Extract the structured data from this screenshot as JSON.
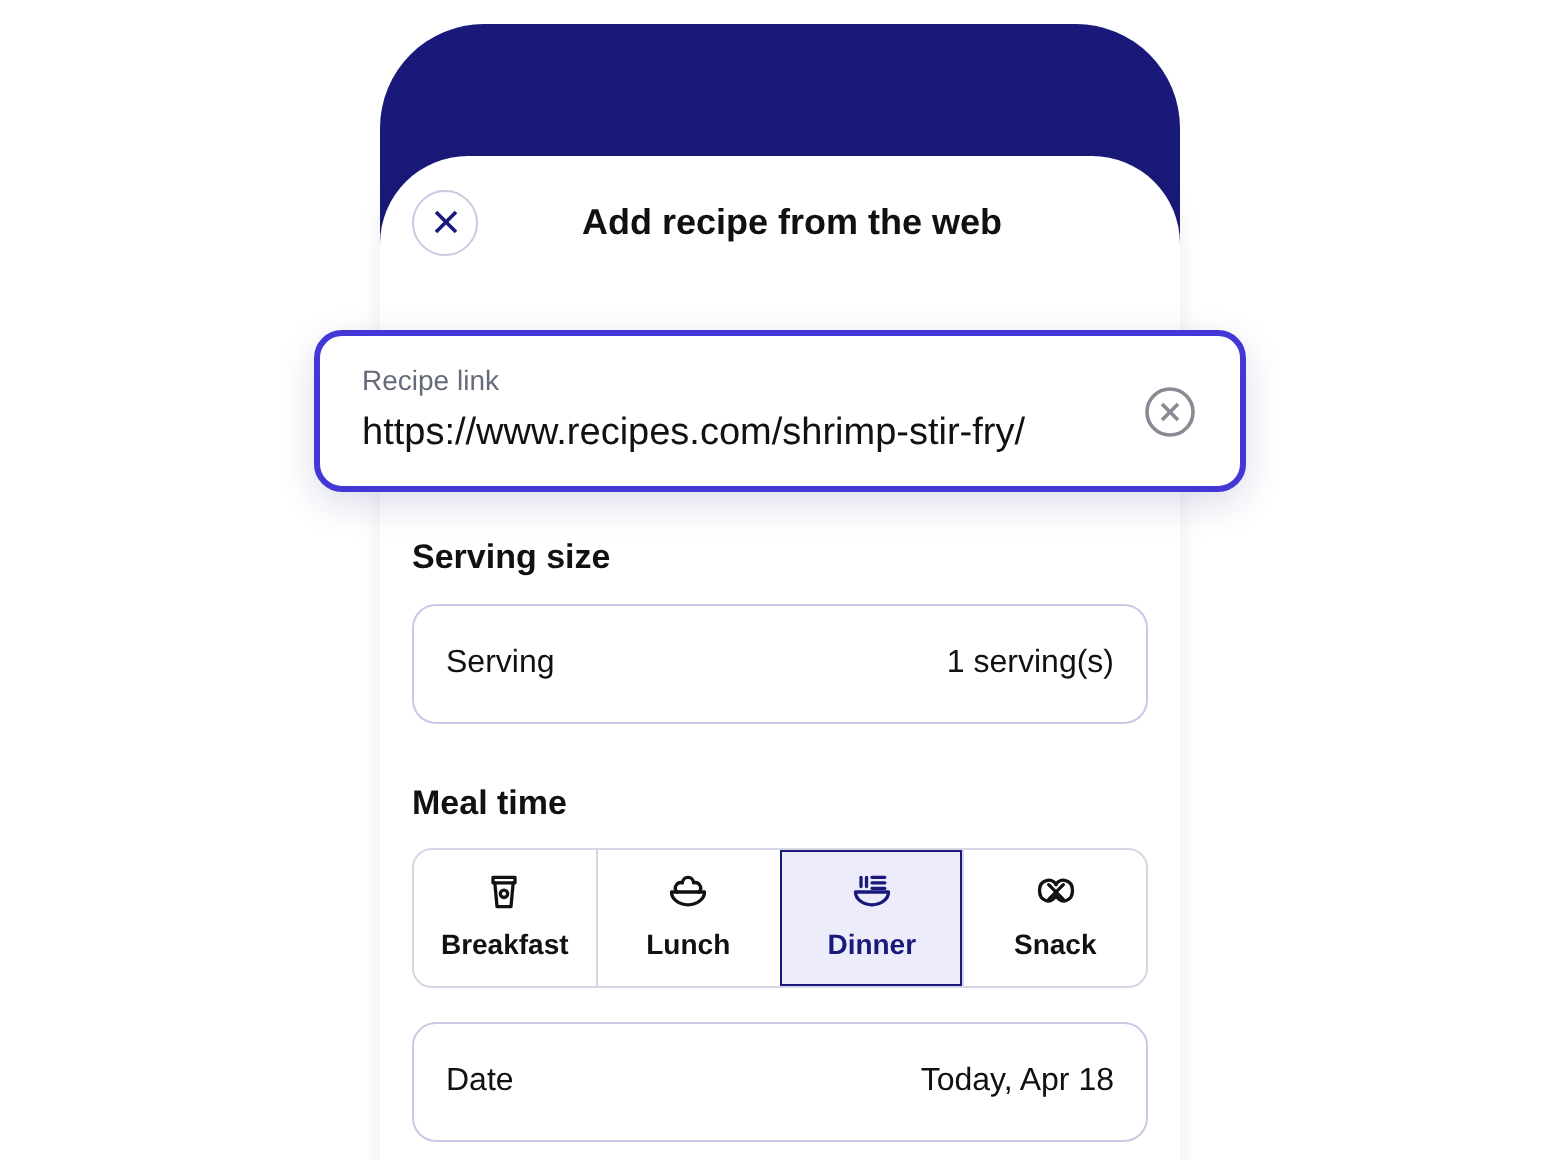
{
  "title": "Add recipe from the web",
  "recipe_link": {
    "label": "Recipe link",
    "value": "https://www.recipes.com/shrimp-stir-fry/"
  },
  "serving_size": {
    "heading": "Serving size",
    "label": "Serving",
    "value": "1 serving(s)"
  },
  "meal_time": {
    "heading": "Meal time",
    "options": [
      {
        "label": "Breakfast",
        "kind": "cup",
        "selected": false
      },
      {
        "label": "Lunch",
        "kind": "salad",
        "selected": false
      },
      {
        "label": "Dinner",
        "kind": "noodles",
        "selected": true
      },
      {
        "label": "Snack",
        "kind": "pretzel",
        "selected": false
      }
    ]
  },
  "date": {
    "label": "Date",
    "value": "Today, Apr 18"
  }
}
